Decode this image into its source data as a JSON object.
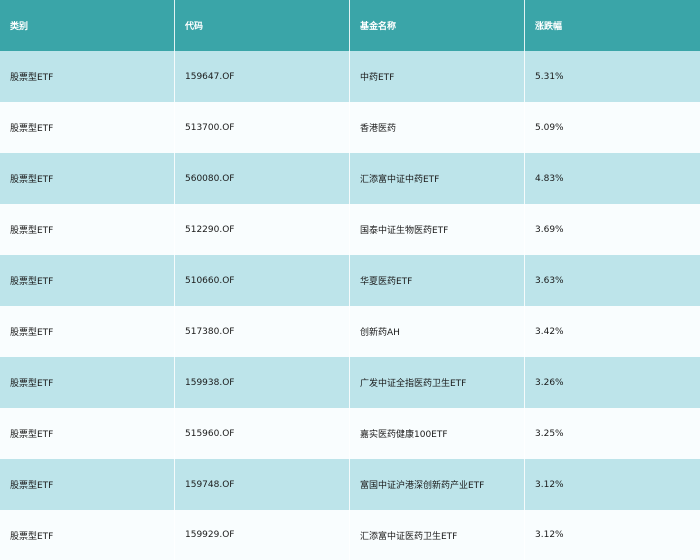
{
  "headers": [
    "类别",
    "代码",
    "基金名称",
    "涨跌幅"
  ],
  "rows": [
    {
      "category": "股票型ETF",
      "code": "159647.OF",
      "name": "中药ETF",
      "change": "5.31%"
    },
    {
      "category": "股票型ETF",
      "code": "513700.OF",
      "name": "香港医药",
      "change": "5.09%"
    },
    {
      "category": "股票型ETF",
      "code": "560080.OF",
      "name": "汇添富中证中药ETF",
      "change": "4.83%"
    },
    {
      "category": "股票型ETF",
      "code": "512290.OF",
      "name": "国泰中证生物医药ETF",
      "change": "3.69%"
    },
    {
      "category": "股票型ETF",
      "code": "510660.OF",
      "name": "华夏医药ETF",
      "change": "3.63%"
    },
    {
      "category": "股票型ETF",
      "code": "517380.OF",
      "name": "创新药AH",
      "change": "3.42%"
    },
    {
      "category": "股票型ETF",
      "code": "159938.OF",
      "name": "广发中证全指医药卫生ETF",
      "change": "3.26%"
    },
    {
      "category": "股票型ETF",
      "code": "515960.OF",
      "name": "嘉实医药健康100ETF",
      "change": "3.25%"
    },
    {
      "category": "股票型ETF",
      "code": "159748.OF",
      "name": "富国中证沪港深创新药产业ETF",
      "change": "3.12%"
    },
    {
      "category": "股票型ETF",
      "code": "159929.OF",
      "name": "汇添富中证医药卫生ETF",
      "change": "3.12%"
    }
  ],
  "colors": {
    "header_bg": "#3aa5a8",
    "row_odd_bg": "#bde4ea",
    "row_even_bg": "#f9fdfe"
  }
}
